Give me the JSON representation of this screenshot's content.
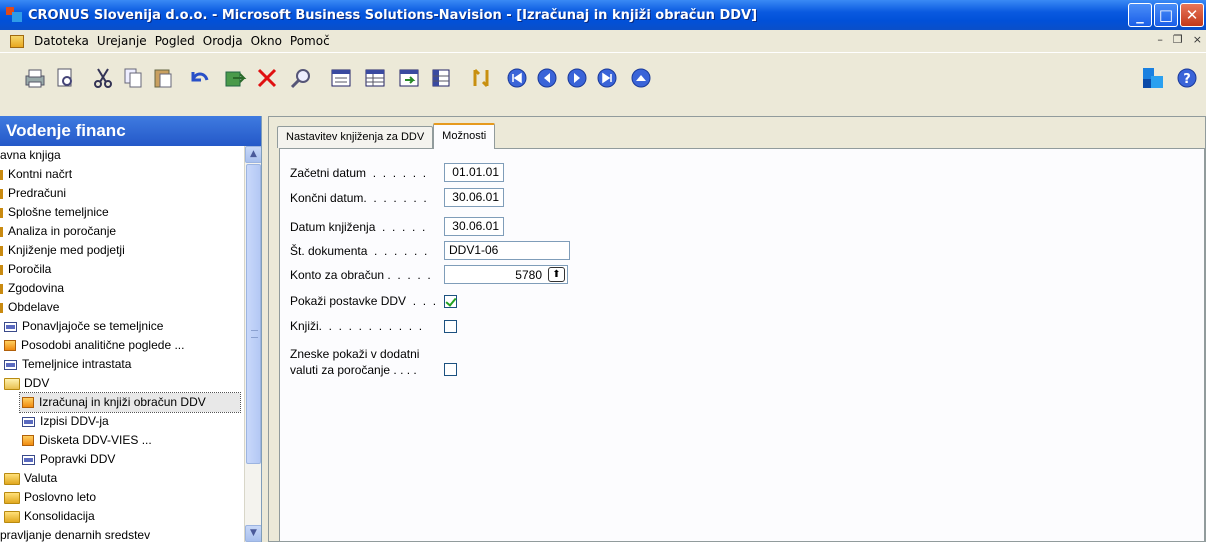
{
  "window": {
    "title": "CRONUS Slovenija d.o.o. - Microsoft Business Solutions-Navision - [Izračunaj in knjiži obračun DDV]"
  },
  "menu": {
    "items": [
      "Datoteka",
      "Urejanje",
      "Pogled",
      "Orodja",
      "Okno",
      "Pomoč"
    ]
  },
  "toolbar": {
    "icons": [
      "print-icon",
      "print-preview-icon",
      "cut-icon",
      "copy-icon",
      "paste-icon",
      "undo-icon",
      "post-icon",
      "delete-icon",
      "find-icon",
      "form-icon",
      "list-icon",
      "card-icon",
      "table-icon",
      "lookup-icon",
      "first-icon",
      "previous-icon",
      "next-icon",
      "last-icon",
      "up-icon",
      "navision-icon",
      "help-icon"
    ]
  },
  "nav": {
    "header": "Vodenje financ",
    "items": [
      {
        "label": "avna knjiga",
        "icon": "none",
        "indent": 0
      },
      {
        "label": "Kontni načrt",
        "icon": "bullet",
        "indent": 0
      },
      {
        "label": "Predračuni",
        "icon": "bullet",
        "indent": 0
      },
      {
        "label": "Splošne temeljnice",
        "icon": "bullet",
        "indent": 0
      },
      {
        "label": "Analiza in poročanje",
        "icon": "bullet",
        "indent": 0
      },
      {
        "label": "Knjiženje med podjetji",
        "icon": "bullet",
        "indent": 0
      },
      {
        "label": "Poročila",
        "icon": "bullet",
        "indent": 0
      },
      {
        "label": "Zgodovina",
        "icon": "bullet",
        "indent": 0
      },
      {
        "label": "Obdelave",
        "icon": "bullet",
        "indent": 0
      },
      {
        "label": "Ponavljajoče se temeljnice",
        "icon": "form",
        "indent": 1
      },
      {
        "label": "Posodobi analitične poglede ...",
        "icon": "report",
        "indent": 1
      },
      {
        "label": "Temeljnice intrastata",
        "icon": "form",
        "indent": 1
      },
      {
        "label": "DDV",
        "icon": "folder-open",
        "indent": 1
      },
      {
        "label": "Izračunaj in knjiži obračun DDV",
        "icon": "report",
        "indent": 2,
        "selected": true
      },
      {
        "label": "Izpisi DDV-ja",
        "icon": "form",
        "indent": 2
      },
      {
        "label": "Disketa DDV-VIES ...",
        "icon": "report",
        "indent": 2
      },
      {
        "label": "Popravki DDV",
        "icon": "form",
        "indent": 2
      },
      {
        "label": "Valuta",
        "icon": "folder",
        "indent": 1
      },
      {
        "label": "Poslovno leto",
        "icon": "folder",
        "indent": 1
      },
      {
        "label": "Konsolidacija",
        "icon": "folder",
        "indent": 1
      },
      {
        "label": "pravljanje denarnih sredstev",
        "icon": "none",
        "indent": 0
      }
    ]
  },
  "tabs": [
    "Nastavitev knjiženja za DDV",
    "Možnosti"
  ],
  "active_tab": "Možnosti",
  "form": {
    "start_date_label": "Začetni datum  .  .  .  .  .  .",
    "start_date": "01.01.01",
    "end_date_label": "Končni datum.  .  .  .  .  .  .",
    "end_date": "30.06.01",
    "posting_date_label": "Datum knjiženja  .  .  .  .  .",
    "posting_date": "30.06.01",
    "doc_no_label": "Št. dokumenta  .  .  .  .  .  .",
    "doc_no": "DDV1-06",
    "account_label": "Konto za obračun .  .  .  .  .",
    "account": "5780",
    "show_vat_label": "Pokaži postavke DDV  .  .  .",
    "show_vat": true,
    "post_label": "Knjiži.  .  .  .  .  .  .  .  .  .  .",
    "post": false,
    "amounts_label_line1": "Zneske pokaži v dodatni",
    "amounts_label_line2": "valuti za poročanje  .  .  .  .",
    "amounts": false
  }
}
